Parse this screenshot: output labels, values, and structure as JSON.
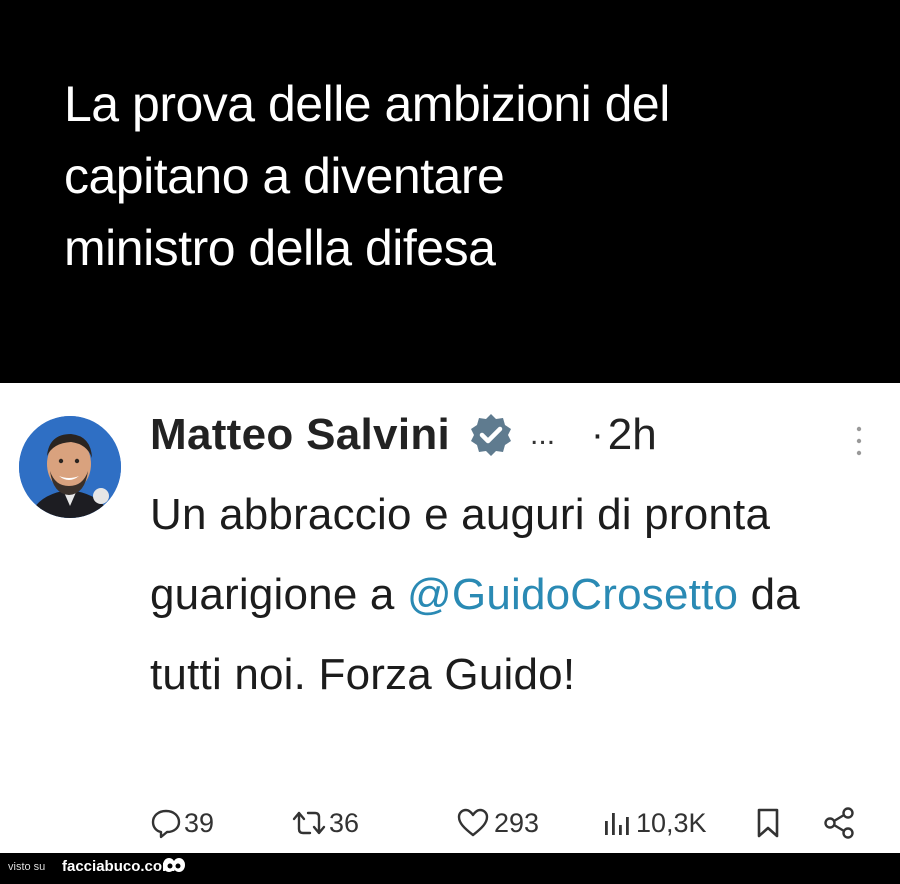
{
  "caption": {
    "text": "La prova delle ambizioni del\ncapitano a diventare\nministro della difesa"
  },
  "tweet": {
    "author_name": "Matteo Salvini",
    "ellipsis": "...",
    "dot": "·",
    "time": "2h",
    "body_before_mention": "Un abbraccio e auguri di pronta guarigione a ",
    "mention": "@GuidoCrosetto",
    "body_after_mention": " da tutti noi. Forza Guido!",
    "stats": {
      "replies": "39",
      "retweets": "36",
      "likes": "293",
      "views": "10,3K"
    },
    "colors": {
      "mention": "#2a8ab4",
      "verified_badge": "#5f7b8f"
    },
    "icons": [
      "reply-icon",
      "retweet-icon",
      "like-icon",
      "views-icon",
      "bookmark-icon",
      "share-icon",
      "verified-icon",
      "more-icon"
    ]
  },
  "credit": {
    "prefix": "visto su",
    "brand": "facciabuco.com"
  }
}
